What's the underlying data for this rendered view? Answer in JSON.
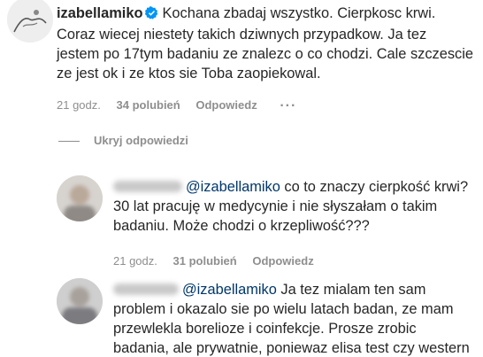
{
  "comments": [
    {
      "username": "izabellamiko",
      "verified": true,
      "text_lines": [
        "Kochana zbadaj wszystko. Cierpkosc krwi.",
        "Coraz wiecej niestety takich dziwnych przypadkow. Ja tez",
        "jestem po 17tym badaniu ze znalezc o co chodzi. Cale szczescie",
        "ze jest ok i ze ktos sie Toba zaopiekowal."
      ],
      "time": "21 godz.",
      "likes": "34 polubień",
      "reply_label": "Odpowiedz",
      "more_icon": "ellipsis-icon"
    }
  ],
  "hide_replies_label": "Ukryj odpowiedzi",
  "replies": [
    {
      "username": "",
      "mention": "@izabellamiko",
      "text_first": " co to znaczy cierpkość krwi?",
      "text_lines": [
        "30 lat pracuję w medycynie i nie słyszałam o takim",
        "badaniu. Może chodzi o krzepliwość???"
      ],
      "time": "21 godz.",
      "likes": "31 polubień",
      "reply_label": "Odpowiedz"
    },
    {
      "username": "",
      "mention": "@izabellamiko",
      "text_first": " Ja tez mialam ten sam",
      "text_lines": [
        "problem i okazalo sie po wielu latach badan, ze mam",
        "przewlekla borelioze i coinfekcje. Prosze zrobic",
        "badania, ale prywatnie, poniewaz elisa test czy western"
      ]
    }
  ],
  "colors": {
    "text": "#262626",
    "meta": "#8e8e8e",
    "mention": "#00376b",
    "verified": "#0095f6"
  }
}
